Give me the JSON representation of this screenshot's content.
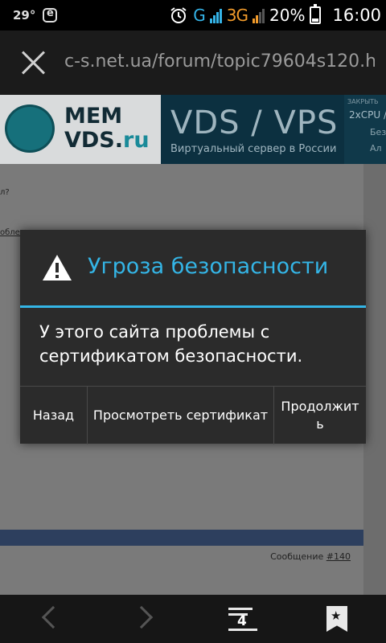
{
  "status_bar": {
    "temperature": "29°",
    "network_1": "G",
    "network_2": "3G",
    "battery_percent": "20%",
    "time": "16:00",
    "icons": [
      "weather-icon",
      "app-e-icon",
      "alarm-icon",
      "signal-icon",
      "battery-icon"
    ]
  },
  "url_bar": {
    "url": "c-s.net.ua/forum/topic79604s120.ht"
  },
  "banner": {
    "logo_line1": "MEM",
    "logo_line2_main": "VDS.",
    "logo_line2_suffix": "ru",
    "title": "VDS / VPS",
    "subtitle": "Виртуальный сервер в России",
    "close_label": "ЗАКРЫТЬ",
    "side_line1": "2xCPU /",
    "side_line2": "Без",
    "side_line3": "Ал"
  },
  "forum": {
    "text_fragment_1": "л?",
    "text_fragment_2": "облем",
    "message_prefix": "Сообщение ",
    "message_link": "#140"
  },
  "dialog": {
    "title": "Угроза безопасности",
    "message": "У этого сайта проблемы с сертификатом безопасности.",
    "buttons": {
      "back": "Назад",
      "view_certificate": "Просмотреть сертификат",
      "continue": "Продолжить"
    },
    "accent_color": "#34b5e6"
  },
  "toolbar": {
    "tabs_count": "4"
  }
}
